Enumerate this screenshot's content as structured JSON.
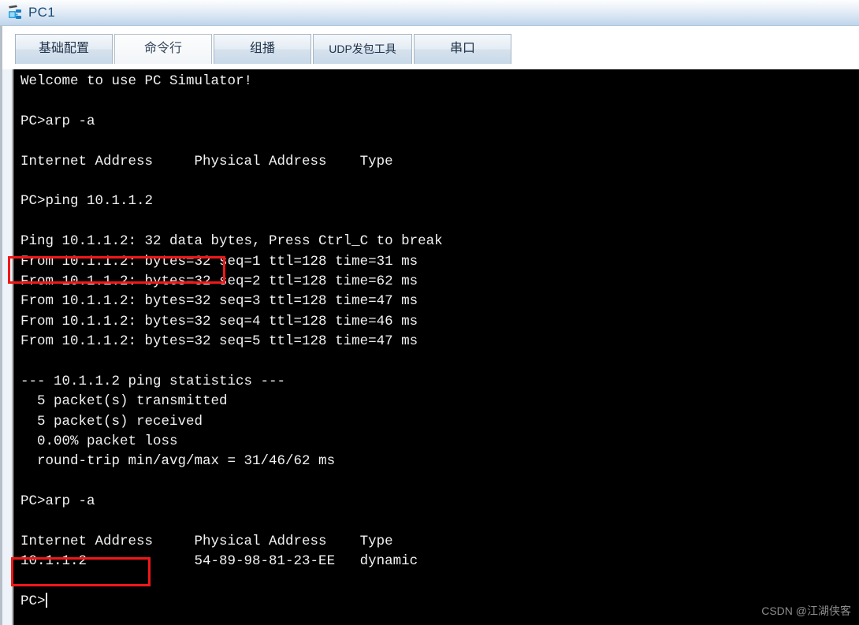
{
  "window": {
    "title": "PC1",
    "icon": "pc-network-icon"
  },
  "tabs": [
    {
      "label": "基础配置",
      "name": "tab-basic-config",
      "active": false
    },
    {
      "label": "命令行",
      "name": "tab-command-line",
      "active": true
    },
    {
      "label": "组播",
      "name": "tab-multicast",
      "active": false
    },
    {
      "label": "UDP发包工具",
      "name": "tab-udp-packet-tool",
      "active": false
    },
    {
      "label": "串口",
      "name": "tab-serial-port",
      "active": false
    }
  ],
  "terminal": {
    "background": "#000000",
    "foreground": "#f2f2f2",
    "lines": [
      "Welcome to use PC Simulator!",
      "",
      "PC>arp -a",
      "",
      "Internet Address     Physical Address    Type",
      "",
      "PC>ping 10.1.1.2",
      "",
      "Ping 10.1.1.2: 32 data bytes, Press Ctrl_C to break",
      "From 10.1.1.2: bytes=32 seq=1 ttl=128 time=31 ms",
      "From 10.1.1.2: bytes=32 seq=2 ttl=128 time=62 ms",
      "From 10.1.1.2: bytes=32 seq=3 ttl=128 time=47 ms",
      "From 10.1.1.2: bytes=32 seq=4 ttl=128 time=46 ms",
      "From 10.1.1.2: bytes=32 seq=5 ttl=128 time=47 ms",
      "",
      "--- 10.1.1.2 ping statistics ---",
      "  5 packet(s) transmitted",
      "  5 packet(s) received",
      "  0.00% packet loss",
      "  round-trip min/avg/max = 31/46/62 ms",
      "",
      "PC>arp -a",
      "",
      "Internet Address     Physical Address    Type",
      "10.1.1.2             54-89-98-81-23-EE   dynamic",
      ""
    ],
    "prompt": "PC>"
  },
  "annotations": {
    "box_color": "#f01818",
    "boxes": [
      {
        "name": "highlight-ping-command",
        "target": "PC>ping 10.1.1.2"
      },
      {
        "name": "highlight-arp-command",
        "target": "PC>arp -a"
      }
    ]
  },
  "watermark": {
    "text": "CSDN @江湖侠客"
  }
}
